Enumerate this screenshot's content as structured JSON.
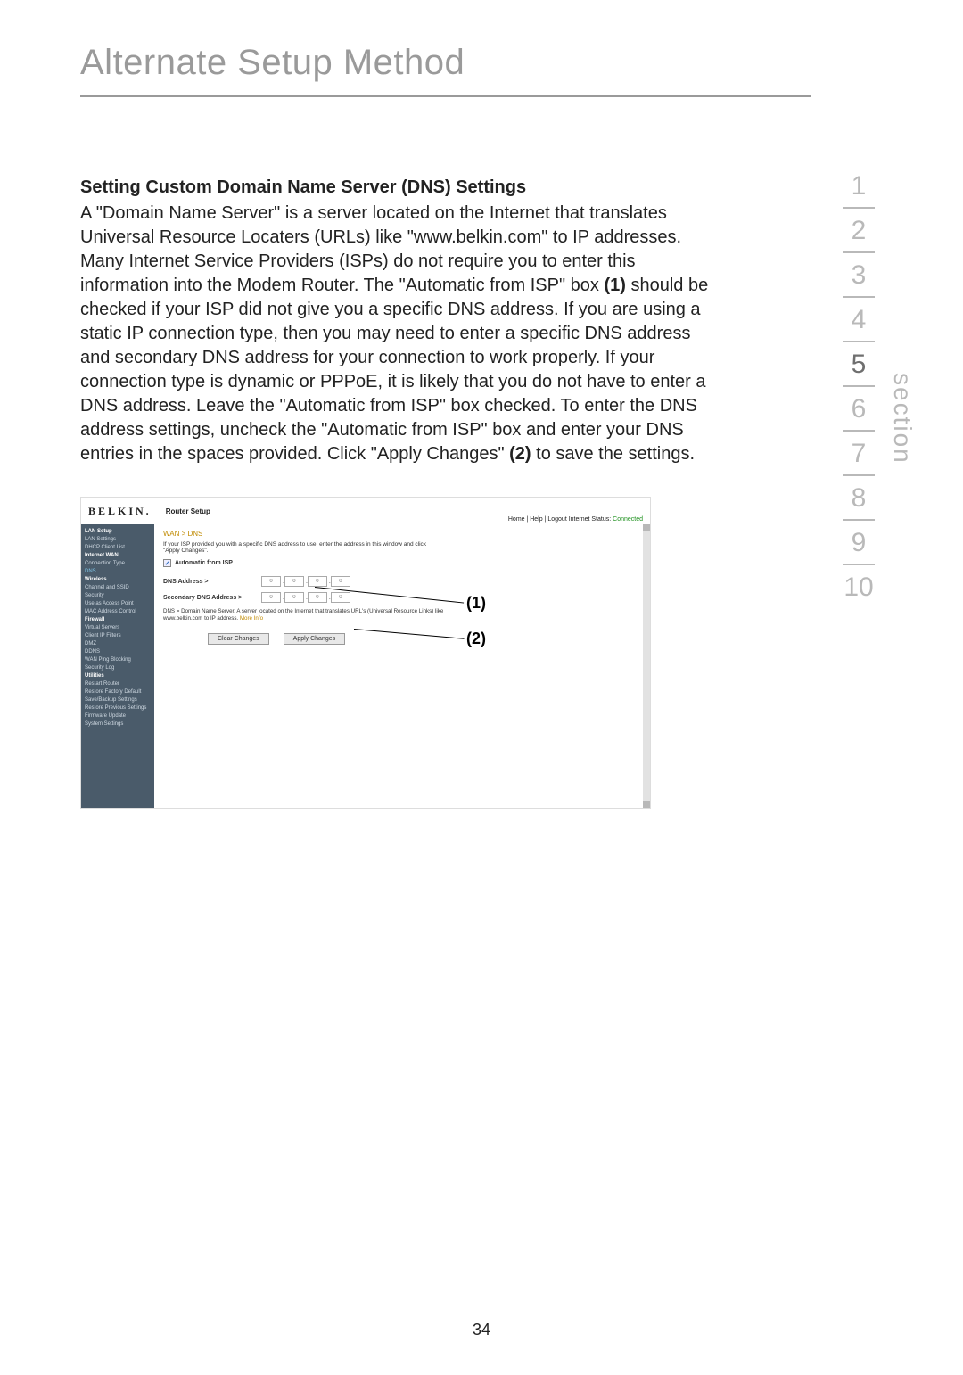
{
  "page_title": "Alternate Setup Method",
  "page_number": "34",
  "section_label": "section",
  "nav": {
    "items": [
      "1",
      "2",
      "3",
      "4",
      "5",
      "6",
      "7",
      "8",
      "9",
      "10"
    ],
    "active_index": 4
  },
  "heading": "Setting Custom Domain Name Server (DNS) Settings",
  "paragraph_parts": {
    "p1": "A \"Domain Name Server\" is a server located on the Internet that translates Universal Resource Locaters (URLs) like \"www.belkin.com\" to IP addresses. Many Internet Service Providers (ISPs) do not require you to enter this information into the Modem Router. The \"Automatic from ISP\" box ",
    "b1": "(1)",
    "p2": " should be checked if your ISP did not give you a specific DNS address. If you are using a static IP connection type, then you may need to enter a specific DNS address and secondary DNS address for your connection to work properly. If your connection type is dynamic or PPPoE, it is likely that you do not have to enter a DNS address. Leave the \"Automatic from ISP\" box checked. To enter the DNS address settings, uncheck the \"Automatic from ISP\" box and enter your DNS entries in the spaces provided. Click \"Apply Changes\" ",
    "b2": "(2)",
    "p3": " to save the settings."
  },
  "callouts": {
    "c1": "(1)",
    "c2": "(2)"
  },
  "router": {
    "brand": "BELKIN.",
    "title": "Router Setup",
    "status_prefix": "Home | Help | Logout   Internet Status: ",
    "status_value": "Connected",
    "breadcrumb": "WAN > DNS",
    "note": "If your ISP provided you with a specific DNS address to use, enter the address in this window and click \"Apply Changes\".",
    "auto_label": "Automatic from ISP",
    "auto_checked": "✓",
    "dns_label": "DNS Address >",
    "dns2_label": "Secondary DNS Address >",
    "ip_placeholder": "0",
    "desc_prefix": "DNS = Domain Name Server. A server located on the Internet that translates URL's (Universal Resource Links) like www.belkin.com to IP address. ",
    "more_info": "More Info",
    "btn_clear": "Clear Changes",
    "btn_apply": "Apply Changes",
    "sidebar": [
      {
        "t": "LAN Setup",
        "c": "hdr"
      },
      {
        "t": "LAN Settings",
        "c": ""
      },
      {
        "t": "DHCP Client List",
        "c": ""
      },
      {
        "t": "Internet WAN",
        "c": "hdr"
      },
      {
        "t": "Connection Type",
        "c": ""
      },
      {
        "t": "DNS",
        "c": "sel"
      },
      {
        "t": "Wireless",
        "c": "hdr"
      },
      {
        "t": "Channel and SSID",
        "c": ""
      },
      {
        "t": "Security",
        "c": ""
      },
      {
        "t": "Use as Access Point",
        "c": ""
      },
      {
        "t": "MAC Address Control",
        "c": ""
      },
      {
        "t": "Firewall",
        "c": "hdr"
      },
      {
        "t": "Virtual Servers",
        "c": ""
      },
      {
        "t": "Client IP Filters",
        "c": ""
      },
      {
        "t": "DMZ",
        "c": ""
      },
      {
        "t": "DDNS",
        "c": ""
      },
      {
        "t": "WAN Ping Blocking",
        "c": ""
      },
      {
        "t": "Security Log",
        "c": ""
      },
      {
        "t": "Utilities",
        "c": "hdr"
      },
      {
        "t": "Restart Router",
        "c": ""
      },
      {
        "t": "Restore Factory Default",
        "c": ""
      },
      {
        "t": "Save/Backup Settings",
        "c": ""
      },
      {
        "t": "Restore Previous Settings",
        "c": ""
      },
      {
        "t": "Firmware Update",
        "c": ""
      },
      {
        "t": "System Settings",
        "c": ""
      }
    ]
  }
}
